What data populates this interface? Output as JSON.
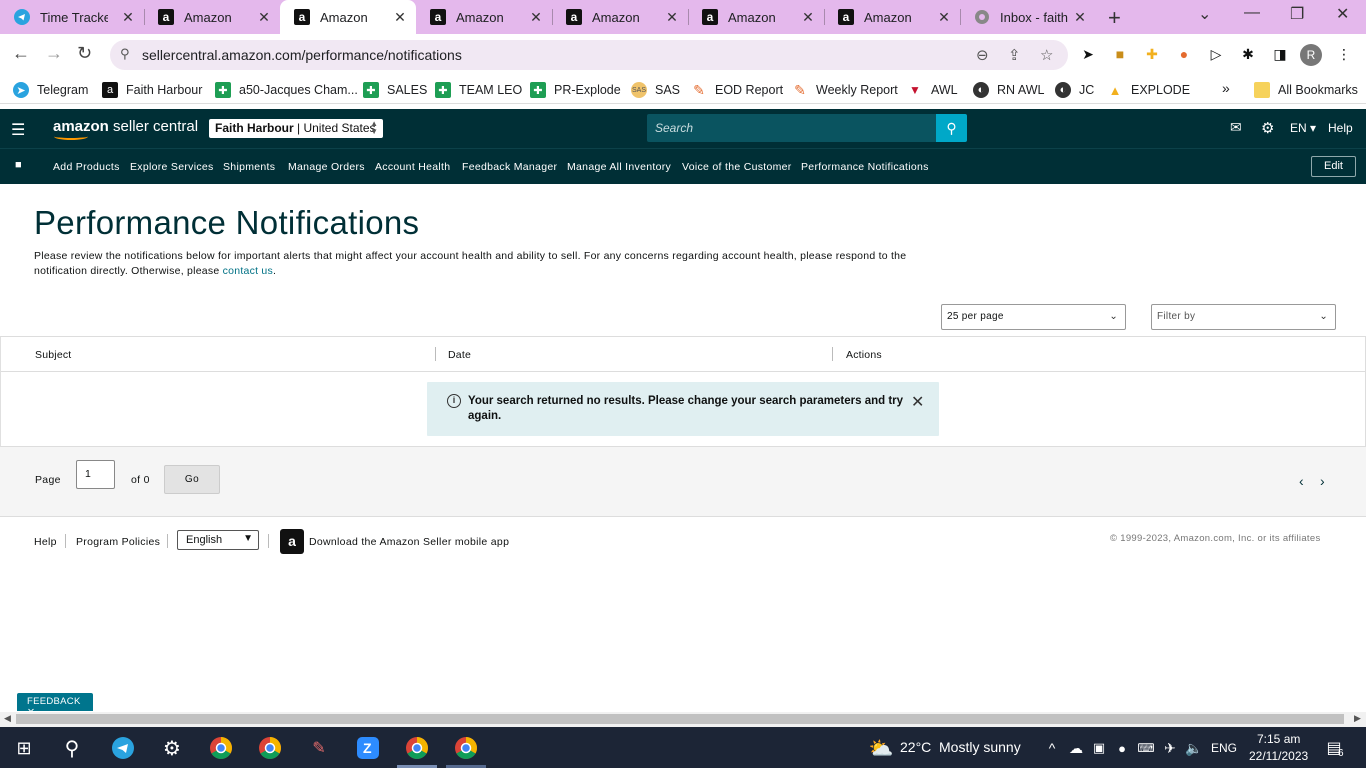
{
  "browser": {
    "tabs": [
      {
        "title": "Time Tracker",
        "favicon": "telegram-icon"
      },
      {
        "title": "Amazon",
        "favicon": "amazon-icon"
      },
      {
        "title": "Amazon",
        "favicon": "amazon-icon",
        "active": true
      },
      {
        "title": "Amazon",
        "favicon": "amazon-icon"
      },
      {
        "title": "Amazon",
        "favicon": "amazon-icon"
      },
      {
        "title": "Amazon",
        "favicon": "amazon-icon"
      },
      {
        "title": "Amazon",
        "favicon": "amazon-icon"
      },
      {
        "title": "Inbox - faith",
        "favicon": "mail-icon"
      }
    ],
    "url": "sellercentral.amazon.com/performance/notifications",
    "profile_initial": "R",
    "bookmarks": [
      {
        "label": "Telegram",
        "icon": "telegram-icon"
      },
      {
        "label": "Faith Harbour",
        "icon": "amazon-icon"
      },
      {
        "label": "a50-Jacques Cham...",
        "icon": "sheets-icon"
      },
      {
        "label": "SALES",
        "icon": "sheets-icon"
      },
      {
        "label": "TEAM LEO",
        "icon": "sheets-icon"
      },
      {
        "label": "PR-Explode",
        "icon": "sheets-icon"
      },
      {
        "label": "SAS",
        "icon": "sas-icon"
      },
      {
        "label": "EOD Report",
        "icon": "pencil-icon"
      },
      {
        "label": "Weekly Report",
        "icon": "pencil-icon"
      },
      {
        "label": "AWL",
        "icon": "awl-icon"
      },
      {
        "label": "RN AWL",
        "icon": "globe-icon"
      },
      {
        "label": "JC",
        "icon": "globe-icon"
      },
      {
        "label": "EXPLODE",
        "icon": "drive-icon"
      }
    ],
    "bookmarks_overflow": "»",
    "all_bookmarks": "All Bookmarks"
  },
  "header": {
    "logo_main": "amazon",
    "logo_sub": " seller central",
    "account_name": "Faith Harbour",
    "account_sep": " | ",
    "account_region": "United States",
    "search_placeholder": "Search",
    "lang": "EN",
    "help": "Help"
  },
  "nav": {
    "items": [
      "Add Products",
      "Explore Services",
      "Shipments",
      "Manage Orders",
      "Account Health",
      "Feedback Manager",
      "Manage All Inventory",
      "Voice of the Customer",
      "Performance Notifications"
    ],
    "edit": "Edit"
  },
  "page": {
    "title": "Performance Notifications",
    "intro_text": "Please review the notifications below for important alerts that might affect your account health and ability to sell. For any concerns regarding account health, please respond to the notification directly. Otherwise, please ",
    "intro_link": "contact us",
    "intro_end": ".",
    "per_page": "25 per page",
    "filter": "Filter by"
  },
  "table": {
    "headers": [
      "Subject",
      "Date",
      "Actions"
    ],
    "empty_message": "Your search returned no results. Please change your search parameters and try again."
  },
  "pager": {
    "page_label": "Page",
    "page_value": "1",
    "of_label": "of 0",
    "go": "Go"
  },
  "footer": {
    "help": "Help",
    "policies": "Program Policies",
    "language": "English",
    "app_text": "Download the Amazon Seller mobile app",
    "copyright": "© 1999-2023, Amazon.com, Inc. or its affiliates"
  },
  "feedback": "FEEDBACK",
  "taskbar": {
    "weather_temp": "22°C",
    "weather_desc": "Mostly sunny",
    "lang": "ENG",
    "time": "7:15 am",
    "date": "22/11/2023",
    "notifications": "6"
  },
  "colors": {
    "header_bg": "#002f36",
    "accent": "#00a8c8",
    "link": "#007185",
    "tabstrip": "#e4b8ec"
  }
}
